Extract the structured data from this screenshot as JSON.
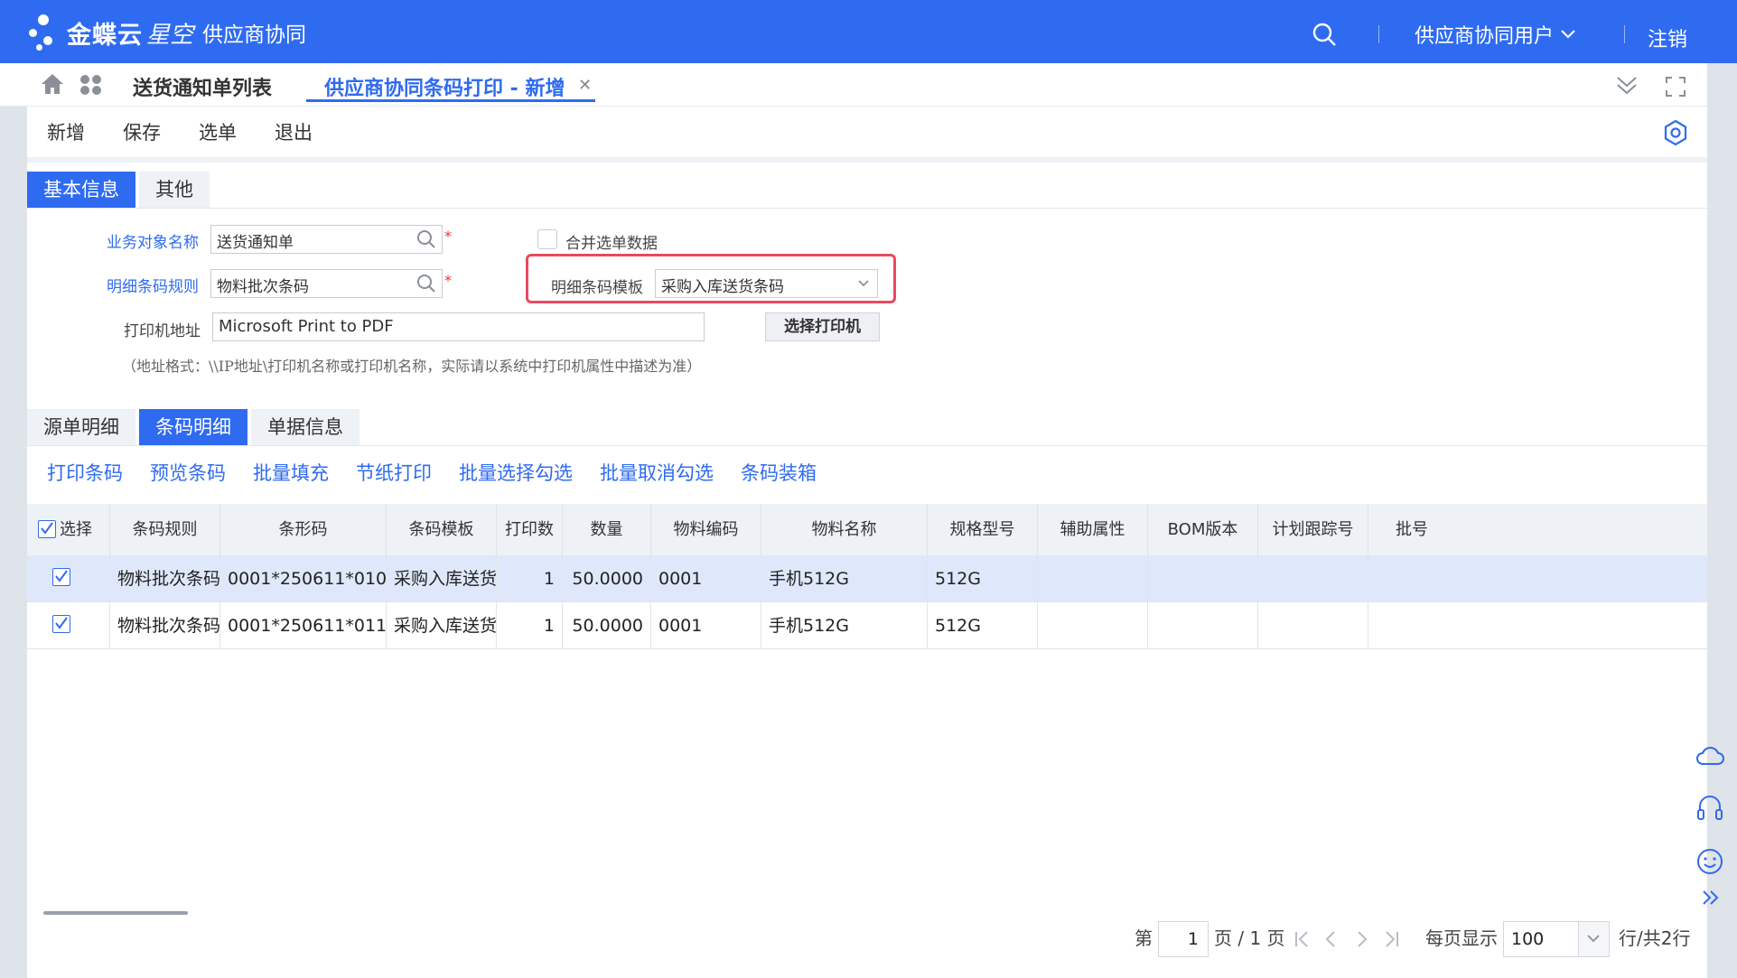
{
  "app": {
    "brand": "金蝶云",
    "brand2": "星空",
    "module": "供应商协同",
    "user": "供应商协同用户",
    "logout": "注销"
  },
  "tabs": {
    "list": "送货通知单列表",
    "current": "供应商协同条码打印 - 新增"
  },
  "toolbar": {
    "new": "新增",
    "save": "保存",
    "select": "选单",
    "exit": "退出"
  },
  "form_tabs": [
    "基本信息",
    "其他"
  ],
  "form": {
    "biz_obj_label": "业务对象名称",
    "biz_obj_value": "送货通知单",
    "rule_label": "明细条码规则",
    "rule_value": "物料批次条码",
    "merge_label": "合并选单数据",
    "template_label": "明细条码模板",
    "template_value": "采购入库送货条码",
    "printer_label": "打印机地址",
    "printer_value": "Microsoft Print to PDF",
    "choose_printer": "选择打印机",
    "hint": "（地址格式：\\\\IP地址\\打印机名称或打印机名称，实际请以系统中打印机属性中描述为准）",
    "required": "*"
  },
  "detail_tabs": [
    "源单明细",
    "条码明细",
    "单据信息"
  ],
  "actions": [
    "打印条码",
    "预览条码",
    "批量填充",
    "节纸打印",
    "批量选择勾选",
    "批量取消勾选",
    "条码装箱"
  ],
  "grid": {
    "headers": [
      "选择",
      "条码规则",
      "条形码",
      "条码模板",
      "打印数",
      "数量",
      "物料编码",
      "物料名称",
      "规格型号",
      "辅助属性",
      "BOM版本",
      "计划跟踪号",
      "批号"
    ],
    "rows": [
      {
        "rule": "物料批次条码",
        "barcode": "0001*250611*010",
        "template": "采购入库送货...",
        "count": "1",
        "qty": "50.0000",
        "code": "0001",
        "name": "手机512G",
        "spec": "512G"
      },
      {
        "rule": "物料批次条码",
        "barcode": "0001*250611*011",
        "template": "采购入库送货...",
        "count": "1",
        "qty": "50.0000",
        "code": "0001",
        "name": "手机512G",
        "spec": "512G"
      }
    ]
  },
  "pager": {
    "prefix": "第",
    "page": "1",
    "of": "页 / 1 页",
    "per_page_label": "每页显示",
    "per_page": "100",
    "total": "行/共2行"
  },
  "colors": {
    "accent": "#2f6bf0",
    "highlight": "#e84a5f"
  }
}
